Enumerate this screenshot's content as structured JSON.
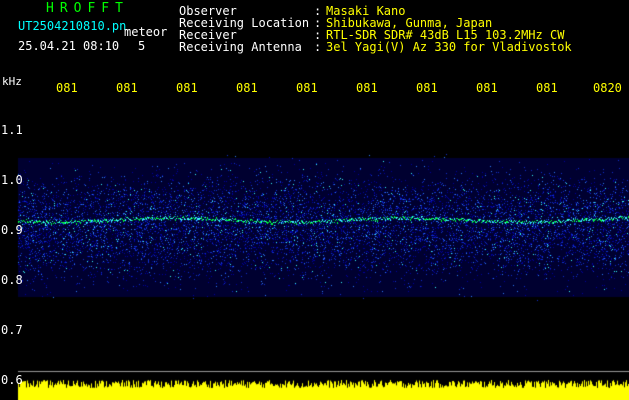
{
  "colors": {
    "title": "#00ff00",
    "file_text": "#00ffff",
    "header_text": "#ffffff",
    "info_label": "#ffffff",
    "info_value": "#ffff00",
    "time_label": "#ffff00",
    "axis_label": "#ffffff",
    "signal_low": "#0000a0",
    "signal_mid": "#2f7cff",
    "signal_high": "#38ffff",
    "signal_trace": "#00ff40",
    "baseline": "#ffff00",
    "gridline": "#ffffff"
  },
  "header": {
    "title": "HROFFT",
    "file_name": "UT2504210810.pn",
    "detection_type": "meteor",
    "datetime": "25.04.21 08:10",
    "count": "5"
  },
  "info": [
    {
      "label": "Observer",
      "colon": ":",
      "value": "Masaki Kano"
    },
    {
      "label": "Receiving Location",
      "colon": ":",
      "value": "Shibukawa, Gunma, Japan"
    },
    {
      "label": "Receiver",
      "colon": ":",
      "value": "RTL-SDR SDR# 43dB L15 103.2MHz CW"
    },
    {
      "label": "Receiving Antenna",
      "colon": ":",
      "value": "3el Yagi(V) Az 330 for Vladivostok"
    }
  ],
  "axis": {
    "unit": "kHz",
    "y_ticks": [
      "1.1",
      "1.0",
      "0.9",
      "0.8",
      "0.7",
      "0.6"
    ],
    "y_tick_values": [
      1.1,
      1.0,
      0.9,
      0.8,
      0.7,
      0.6
    ],
    "time_labels": [
      "081",
      "081",
      "081",
      "081",
      "081",
      "081",
      "081",
      "081",
      "081",
      "0820"
    ]
  },
  "spectrogram": {
    "freq_range_khz": [
      0.6,
      1.15
    ],
    "noise_band_khz": [
      0.77,
      1.04
    ],
    "carrier_khz": 0.92,
    "baseline_khz": 0.61
  }
}
